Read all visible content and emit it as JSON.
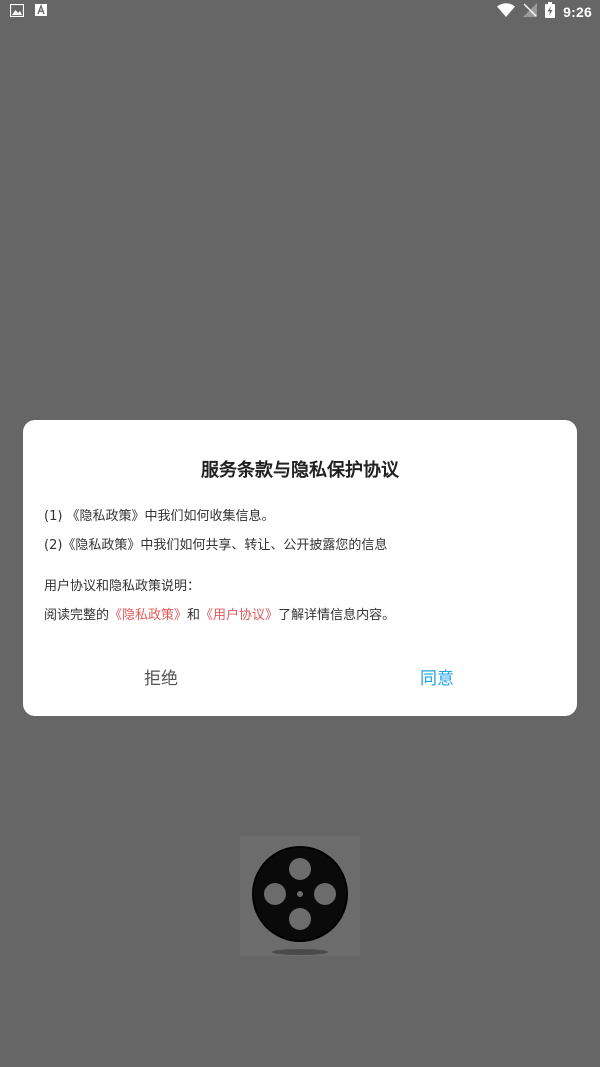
{
  "status_bar": {
    "time": "9:26",
    "left_icons": [
      "image-icon",
      "font-icon"
    ],
    "right_icons": [
      "wifi-icon",
      "no-signal-icon",
      "battery-charging-icon"
    ]
  },
  "dialog": {
    "title": "服务条款与隐私保护协议",
    "line1": "(1) 《隐私政策》中我们如何收集信息。",
    "line2": "(2)《隐私政策》中我们如何共享、转让、公开披露您的信息",
    "line3": "用户协议和隐私政策说明：",
    "line4_prefix": "阅读完整的",
    "link_privacy": "《隐私政策》",
    "line4_and": "和",
    "link_user_agreement": "《用户协议》",
    "line4_suffix": "了解详情信息内容。",
    "refuse_label": "拒绝",
    "agree_label": "同意"
  },
  "colors": {
    "backdrop": "#666666",
    "link": "#e05a5a",
    "agree": "#1aa5e8",
    "refuse": "#555555"
  },
  "app_logo": "film-reel-icon"
}
